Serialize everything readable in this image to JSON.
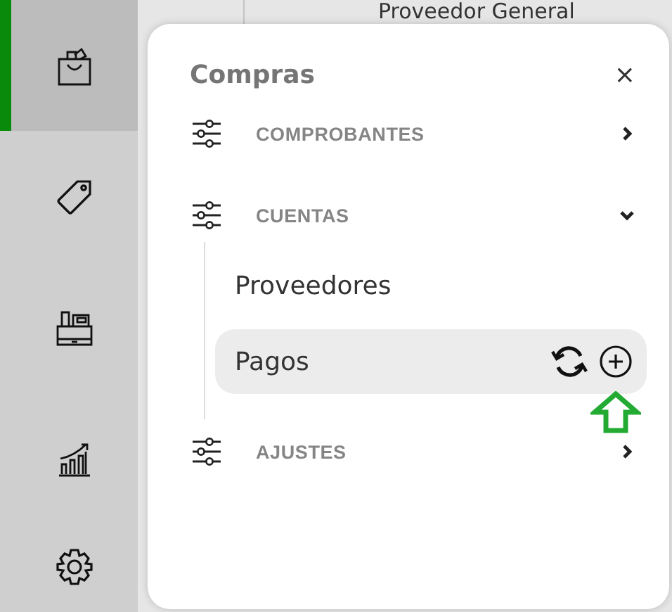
{
  "sidebar": {
    "items": [
      {
        "kind": "bag",
        "selected": true
      },
      {
        "kind": "tag",
        "selected": false
      },
      {
        "kind": "register",
        "selected": false
      },
      {
        "kind": "chart",
        "selected": false
      },
      {
        "kind": "gear",
        "selected": false
      }
    ]
  },
  "background": {
    "text": "Proveedor General"
  },
  "panel": {
    "title": "Compras",
    "close": "×",
    "sections": [
      {
        "label": "COMPROBANTES",
        "expanded": false
      },
      {
        "label": "CUENTAS",
        "expanded": true,
        "children": [
          {
            "label": "Proveedores",
            "selected": false
          },
          {
            "label": "Pagos",
            "selected": true
          }
        ]
      },
      {
        "label": "AJUSTES",
        "expanded": false
      }
    ]
  }
}
